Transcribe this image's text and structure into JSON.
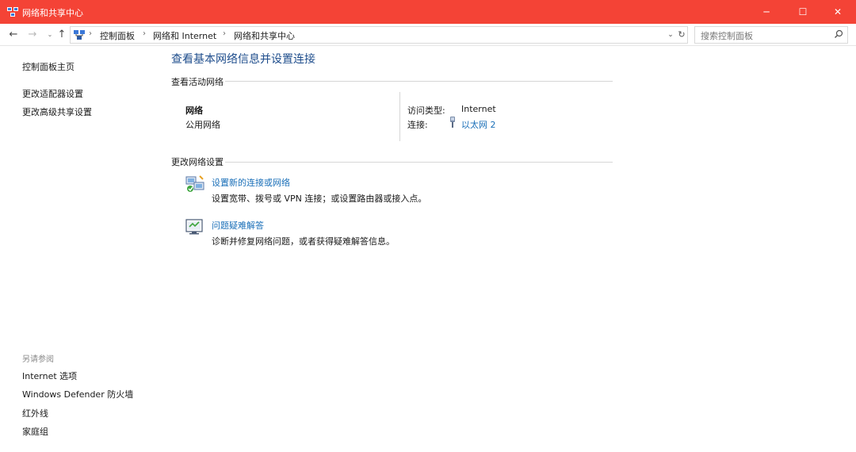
{
  "window": {
    "title": "网络和共享中心",
    "accent": "#f44336",
    "controls": {
      "minimize": "─",
      "maximize": "☐",
      "close": "✕"
    }
  },
  "nav": {
    "back": "←",
    "forward": "→",
    "recent": "⌄",
    "up": "↑"
  },
  "address": {
    "crumbs": [
      "控制面板",
      "网络和 Internet",
      "网络和共享中心"
    ],
    "separator": "›",
    "dropdown": "⌄",
    "refresh": "↻"
  },
  "search": {
    "placeholder": "搜索控制面板",
    "icon": "search-icon"
  },
  "sidebar": {
    "items": [
      {
        "label": "控制面板主页"
      },
      {
        "label": "更改适配器设置"
      },
      {
        "label": "更改高级共享设置"
      }
    ],
    "see_also_heading": "另请参阅",
    "see_also": [
      {
        "label": "Internet 选项"
      },
      {
        "label": "Windows Defender 防火墙"
      },
      {
        "label": "红外线"
      },
      {
        "label": "家庭组"
      }
    ]
  },
  "main": {
    "title": "查看基本网络信息并设置连接",
    "active_networks": {
      "heading": "查看活动网络",
      "network_name": "网络",
      "network_type": "公用网络",
      "access_type_label": "访问类型:",
      "access_type_value": "Internet",
      "connections_label": "连接:",
      "connection_name": "以太网 2",
      "link_color": "#1a6fb8"
    },
    "change_settings": {
      "heading": "更改网络设置",
      "tasks": [
        {
          "link": "设置新的连接或网络",
          "description": "设置宽带、拨号或 VPN 连接；或设置路由器或接入点。",
          "icon": "new-connection-icon"
        },
        {
          "link": "问题疑难解答",
          "description": "诊断并修复网络问题，或者获得疑难解答信息。",
          "icon": "troubleshoot-icon"
        }
      ]
    }
  }
}
